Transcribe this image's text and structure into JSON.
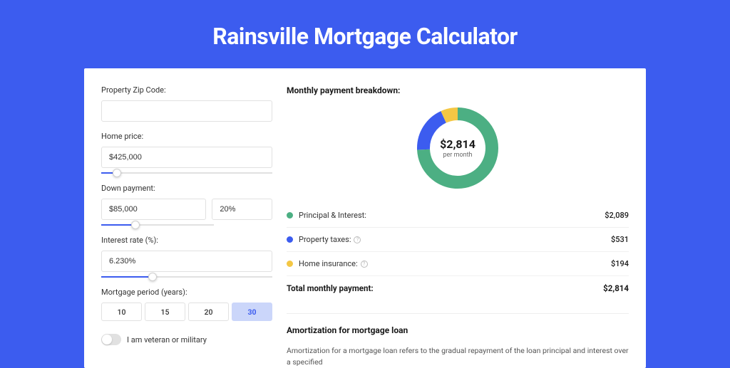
{
  "title": "Rainsville Mortgage Calculator",
  "form": {
    "zip_label": "Property Zip Code:",
    "zip_value": "",
    "home_price_label": "Home price:",
    "home_price_value": "$425,000",
    "home_price_slider_pct": 9,
    "down_payment_label": "Down payment:",
    "down_payment_value": "$85,000",
    "down_payment_pct": "20%",
    "down_payment_slider_pct": 20,
    "interest_label": "Interest rate (%):",
    "interest_value": "6.230%",
    "interest_slider_pct": 30,
    "period_label": "Mortgage period (years):",
    "period_options": [
      "10",
      "15",
      "20",
      "30"
    ],
    "period_selected": "30",
    "veteran_label": "I am veteran or military"
  },
  "breakdown": {
    "title": "Monthly payment breakdown:",
    "center_amount": "$2,814",
    "center_sub": "per month",
    "items": [
      {
        "label": "Principal & Interest:",
        "value": "$2,089",
        "color": "#4CAF83",
        "info": false
      },
      {
        "label": "Property taxes:",
        "value": "$531",
        "color": "#3C5CEF",
        "info": true
      },
      {
        "label": "Home insurance:",
        "value": "$194",
        "color": "#F4C744",
        "info": true
      }
    ],
    "total_label": "Total monthly payment:",
    "total_value": "$2,814"
  },
  "amortization": {
    "title": "Amortization for mortgage loan",
    "text": "Amortization for a mortgage loan refers to the gradual repayment of the loan principal and interest over a specified"
  },
  "chart_data": {
    "type": "pie",
    "title": "Monthly payment breakdown",
    "series": [
      {
        "name": "Principal & Interest",
        "value": 2089
      },
      {
        "name": "Property taxes",
        "value": 531
      },
      {
        "name": "Home insurance",
        "value": 194
      }
    ],
    "total": 2814,
    "colors": [
      "#4CAF83",
      "#3C5CEF",
      "#F4C744"
    ]
  }
}
